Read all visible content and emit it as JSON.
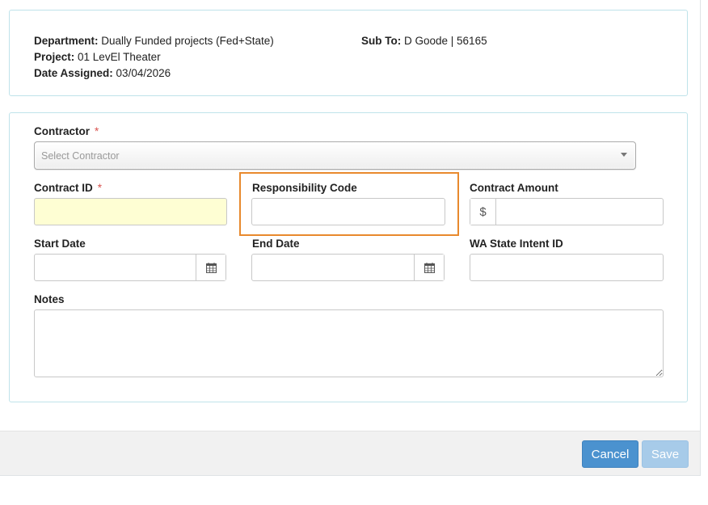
{
  "info": {
    "department_label": "Department:",
    "department_value": "Dually Funded projects (Fed+State)",
    "sub_to_label": "Sub To:",
    "sub_to_value": "D Goode | 56165",
    "project_label": "Project:",
    "project_value": "01 LevEl Theater",
    "date_assigned_label": "Date Assigned:",
    "date_assigned_value": "03/04/2026"
  },
  "form": {
    "contractor_label": "Contractor",
    "required_mark": "*",
    "contractor_placeholder": "Select Contractor",
    "contract_id_label": "Contract ID",
    "contract_id_value": "",
    "responsibility_code_label": "Responsibility Code",
    "responsibility_code_value": "",
    "contract_amount_label": "Contract Amount",
    "currency_symbol": "$",
    "contract_amount_value": "",
    "start_date_label": "Start Date",
    "start_date_value": "",
    "end_date_label": "End Date",
    "end_date_value": "",
    "wa_state_intent_label": "WA State Intent ID",
    "wa_state_intent_value": "",
    "notes_label": "Notes",
    "notes_value": ""
  },
  "footer": {
    "cancel_label": "Cancel",
    "save_label": "Save"
  },
  "colors": {
    "accent": "#4b92cf",
    "highlight": "#e8892d",
    "required": "#d9534f",
    "required_field_bg": "#fefed3"
  },
  "icons": {
    "calendar": "calendar-icon",
    "dropdown": "chevron-down-icon"
  }
}
